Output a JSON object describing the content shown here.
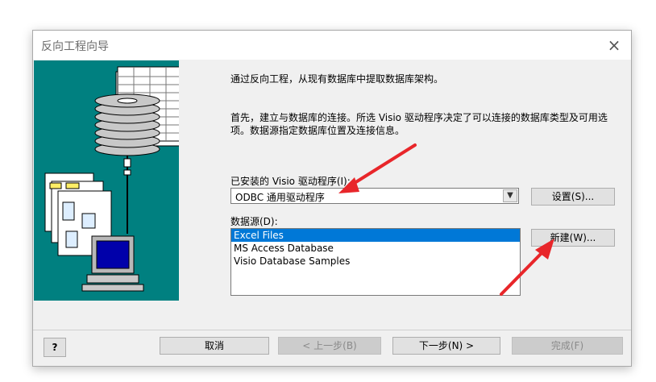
{
  "window": {
    "title": "反向工程向导",
    "close_icon": "×"
  },
  "intro": {
    "line1": "通过反向工程，从现有数据库中提取数据库架构。"
  },
  "description": {
    "line1": "首先，建立与数据库的连接。所选 Visio 驱动程序决定了可以连接的数据库类型及可用选",
    "line2": "项。数据源指定数据库位置及连接信息。"
  },
  "driver": {
    "label": "已安装的 Visio 驱动程序(I):",
    "selected": "ODBC 通用驱动程序",
    "settings_label": "设置(S)..."
  },
  "datasource": {
    "label": "数据源(D):",
    "items": [
      "Excel Files",
      "MS Access Database",
      "Visio Database Samples"
    ],
    "new_label": "新建(W)..."
  },
  "footer": {
    "help_label": "?",
    "cancel_label": "取消",
    "back_label": "< 上一步(B)",
    "next_label": "下一步(N) >",
    "finish_label": "完成(F)"
  },
  "colors": {
    "accent": "#0078d7",
    "art_background": "#008080",
    "annotation_arrow": "#e8262a"
  }
}
